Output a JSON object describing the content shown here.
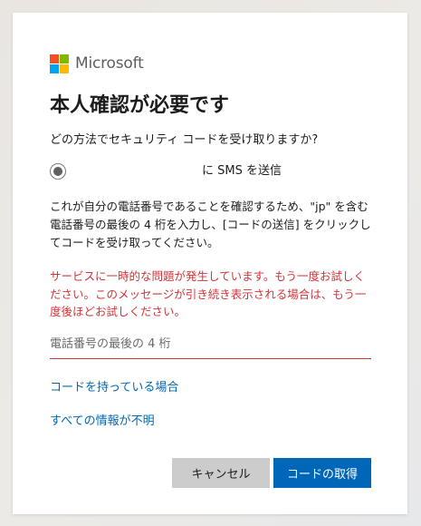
{
  "brand": {
    "name": "Microsoft",
    "colors": {
      "red": "#f25022",
      "green": "#7fba00",
      "blue": "#00a4ef",
      "yellow": "#ffb900"
    }
  },
  "title": "本人確認が必要です",
  "question": "どの方法でセキュリティ コードを受け取りますか?",
  "option": {
    "label": "に SMS を送信",
    "selected": true
  },
  "description": "これが自分の電話番号であることを確認するため、\"jp\" を含む電話番号の最後の 4 桁を入力し、[コードの送信] をクリックしてコードを受け取ってください。",
  "error": "サービスに一時的な問題が発生しています。もう一度お試しください。このメッセージが引き続き表示される場合は、もう一度後ほどお試しください。",
  "phone_input": {
    "placeholder": "電話番号の最後の 4 桁",
    "value": ""
  },
  "links": {
    "have_code": "コードを持っている場合",
    "no_info": "すべての情報が不明"
  },
  "buttons": {
    "cancel": "キャンセル",
    "get_code": "コードの取得"
  },
  "colors": {
    "accent": "#0067b8",
    "error": "#d13438"
  }
}
